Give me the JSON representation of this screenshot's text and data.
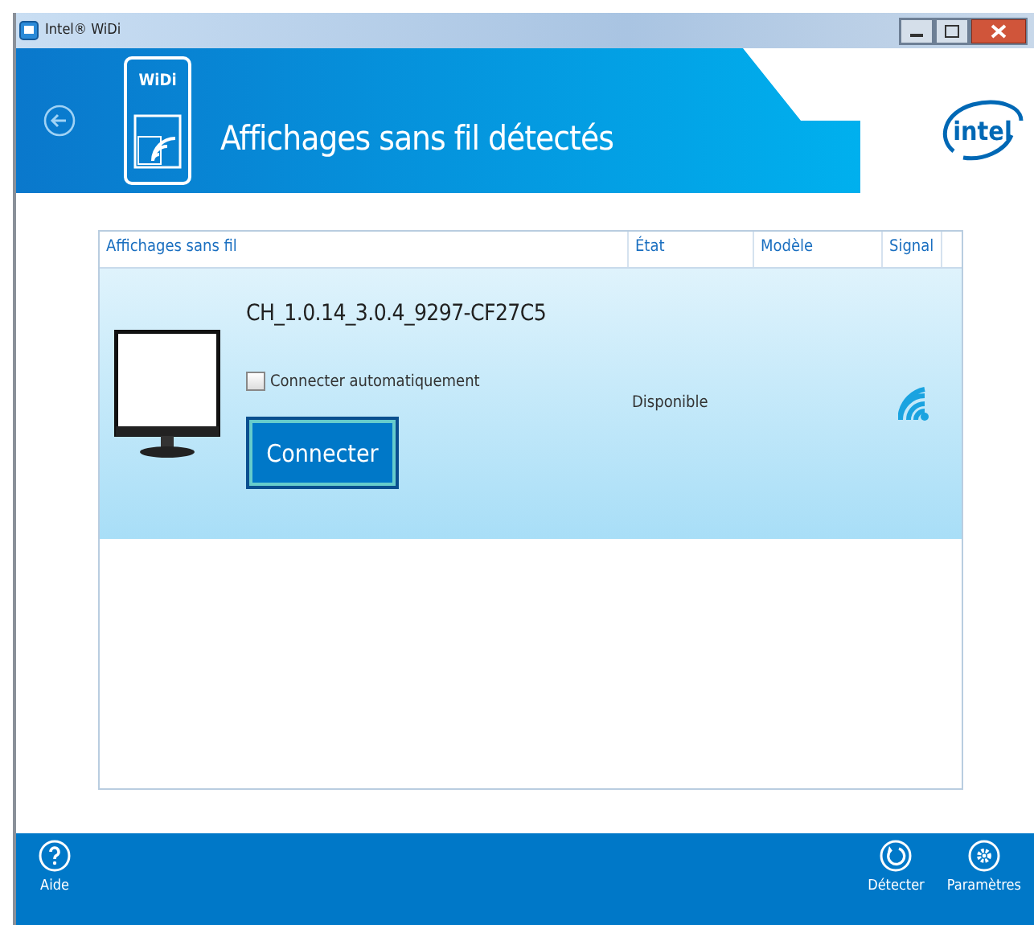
{
  "window": {
    "title": "Intel® WiDi"
  },
  "header": {
    "title": "Affichages sans fil détectés",
    "widi_logo": "WiDi",
    "brand_logo": "intel"
  },
  "table": {
    "columns": [
      "Affichages sans fil",
      "État",
      "Modèle",
      "Signal"
    ],
    "rows": [
      {
        "name": "CH_1.0.14_3.0.4_9297-CF27C5",
        "auto_connect": {
          "label": "Connecter automatiquement",
          "checked": false
        },
        "button": "Connecter",
        "status": "Disponible",
        "selected": true
      }
    ]
  },
  "footer": {
    "left": [
      {
        "label": "Aide",
        "kind": "help"
      }
    ],
    "right": [
      {
        "label": "Détecter",
        "kind": "refresh"
      },
      {
        "label": "Paramètres",
        "kind": "settings"
      }
    ]
  }
}
